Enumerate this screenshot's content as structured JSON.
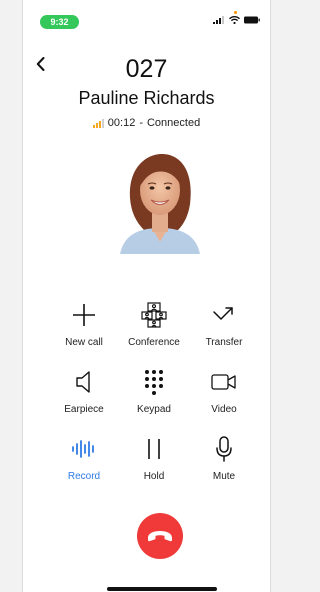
{
  "status_bar": {
    "time": "9:32",
    "accent": "#34c759"
  },
  "call": {
    "number": "027",
    "name": "Pauline Richards",
    "duration": "00:12",
    "separator": "-",
    "state": "Connected"
  },
  "actions": [
    {
      "label": "New call",
      "icon": "plus-icon"
    },
    {
      "label": "Conference",
      "icon": "conference-icon"
    },
    {
      "label": "Transfer",
      "icon": "transfer-icon"
    },
    {
      "label": "Earpiece",
      "icon": "speaker-icon"
    },
    {
      "label": "Keypad",
      "icon": "keypad-icon"
    },
    {
      "label": "Video",
      "icon": "video-icon"
    },
    {
      "label": "Record",
      "icon": "waveform-icon",
      "active": true
    },
    {
      "label": "Hold",
      "icon": "pause-icon"
    },
    {
      "label": "Mute",
      "icon": "microphone-icon"
    }
  ],
  "colors": {
    "end_call": "#f03a3a",
    "active": "#2f7be6",
    "signal": "#f5a623"
  }
}
